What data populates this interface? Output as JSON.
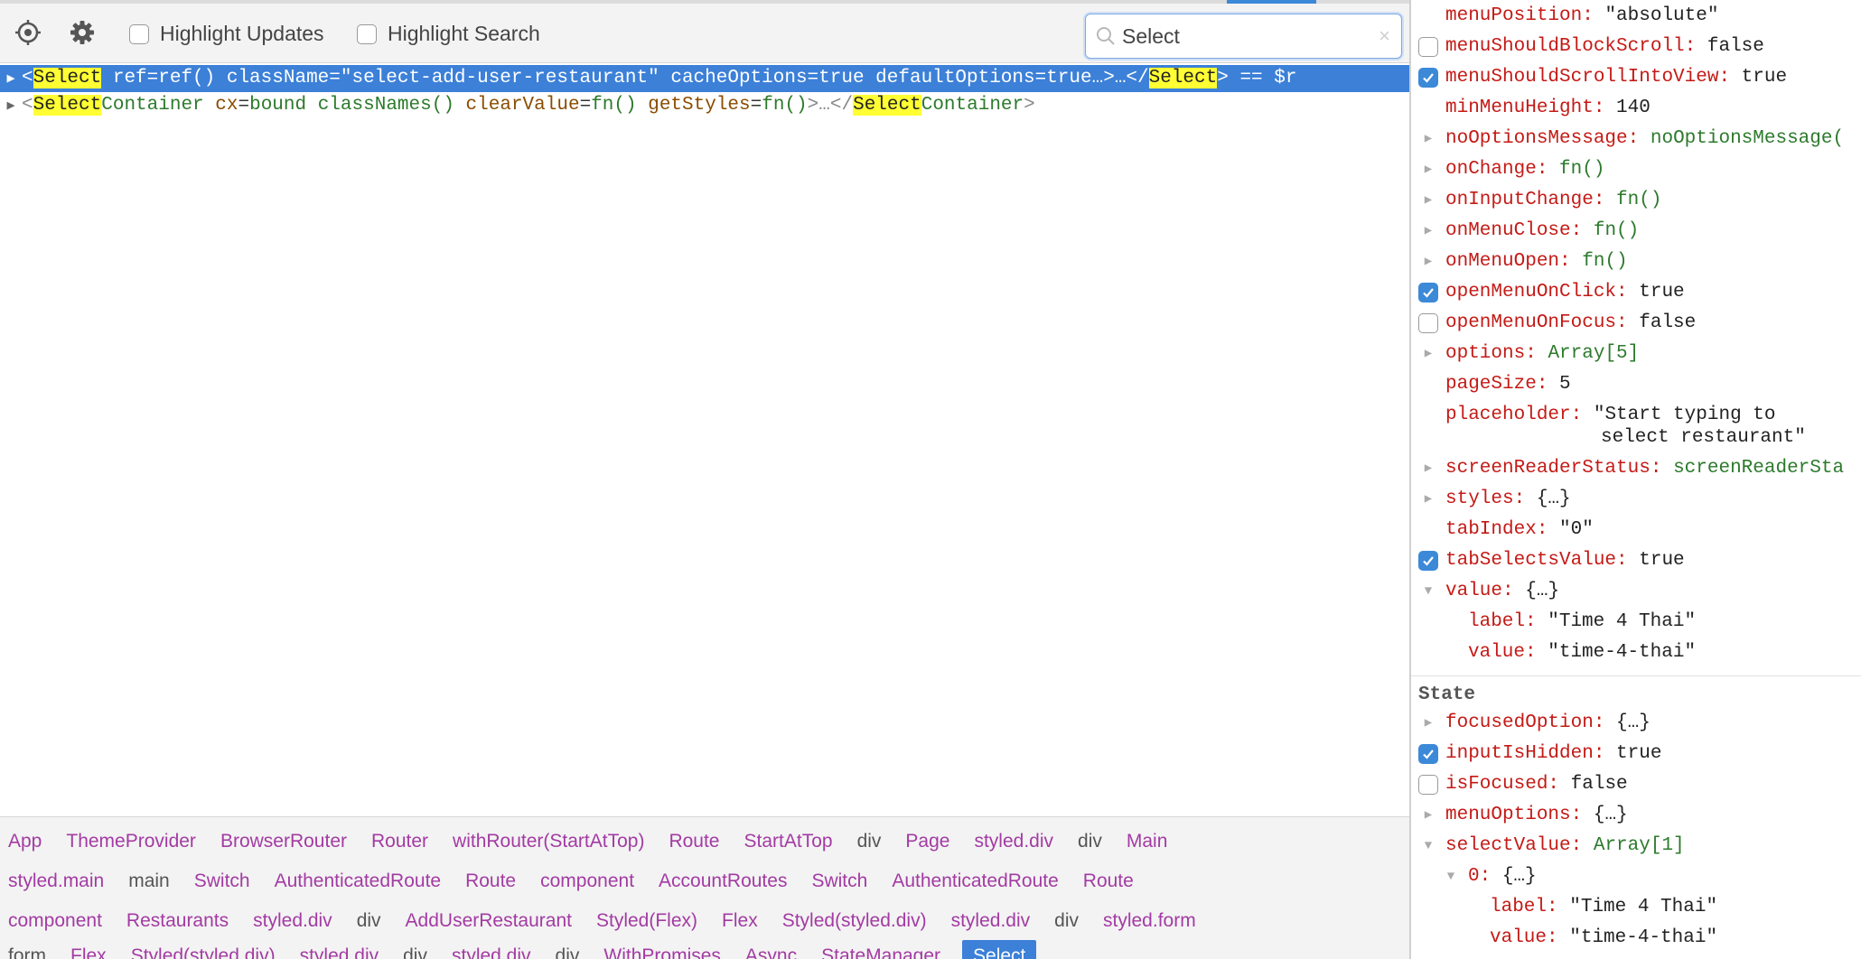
{
  "toolbar": {
    "target_icon": "crosshair-target-icon",
    "settings_icon": "gear-icon",
    "highlight_updates_label": "Highlight Updates",
    "highlight_search_label": "Highlight Search",
    "search_value": "Select",
    "search_icon": "search-icon",
    "clear_icon": "close-icon",
    "clear_glyph": "×"
  },
  "tree": {
    "row1": {
      "open": "<",
      "name": "Select",
      "attrs": " ref=ref() className=\"select-add-user-restaurant\" cacheOptions=true defaultOptions=true…>…</",
      "close_name": "Select",
      "tail": "> == $r"
    },
    "row2": {
      "open": "<",
      "name_hl": "Select",
      "name_rest": "Container",
      "a1n": "cx",
      "a1v": "bound classNames()",
      "a2n": "clearValue",
      "a2v": "fn()",
      "a3n": "getStyles",
      "a3v": "fn()",
      "mid": ">…</",
      "close_hl": "Select",
      "close_rest": "Container",
      "end": ">"
    }
  },
  "breadcrumbs": {
    "row1": [
      "App",
      "ThemeProvider",
      "BrowserRouter",
      "Router",
      "withRouter(StartAtTop)",
      "Route",
      "StartAtTop",
      "div",
      "Page",
      "styled.div",
      "div",
      "Main"
    ],
    "row2": [
      "styled.main",
      "main",
      "Switch",
      "AuthenticatedRoute",
      "Route",
      "component",
      "AccountRoutes",
      "Switch",
      "AuthenticatedRoute",
      "Route"
    ],
    "row3": [
      "component",
      "Restaurants",
      "styled.div",
      "div",
      "AddUserRestaurant",
      "Styled(Flex)",
      "Flex",
      "Styled(styled.div)",
      "styled.div",
      "div",
      "styled.form"
    ],
    "row4": [
      "form",
      "Flex",
      "Styled(styled.div)",
      "styled.div",
      "div",
      "styled.div",
      "div",
      "WithPromises",
      "Async",
      "StateManager",
      "Select"
    ]
  },
  "props": {
    "menuPosition": {
      "key": "menuPosition:",
      "val": "\"absolute\""
    },
    "menuShouldBlockScroll": {
      "key": "menuShouldBlockScroll:",
      "val": "false"
    },
    "menuShouldScrollIntoView": {
      "key": "menuShouldScrollIntoView:",
      "val": "true"
    },
    "minMenuHeight": {
      "key": "minMenuHeight:",
      "val": "140"
    },
    "noOptionsMessage": {
      "key": "noOptionsMessage:",
      "val": "noOptionsMessage("
    },
    "onChange": {
      "key": "onChange:",
      "val": "fn()"
    },
    "onInputChange": {
      "key": "onInputChange:",
      "val": "fn()"
    },
    "onMenuClose": {
      "key": "onMenuClose:",
      "val": "fn()"
    },
    "onMenuOpen": {
      "key": "onMenuOpen:",
      "val": "fn()"
    },
    "openMenuOnClick": {
      "key": "openMenuOnClick:",
      "val": "true"
    },
    "openMenuOnFocus": {
      "key": "openMenuOnFocus:",
      "val": "false"
    },
    "options": {
      "key": "options:",
      "val": "Array[5]"
    },
    "pageSize": {
      "key": "pageSize:",
      "val": "5"
    },
    "placeholder": {
      "key": "placeholder:",
      "val_line1": "\"Start typing to",
      "val_line2": "select restaurant\""
    },
    "screenReaderStatus": {
      "key": "screenReaderStatus:",
      "val": "screenReaderSta"
    },
    "styles": {
      "key": "styles:",
      "val": "{…}"
    },
    "tabIndex": {
      "key": "tabIndex:",
      "val": "\"0\""
    },
    "tabSelectsValue": {
      "key": "tabSelectsValue:",
      "val": "true"
    },
    "value": {
      "key": "value:",
      "val": "{…}"
    },
    "value_label": {
      "key": "label:",
      "val": "\"Time 4 Thai\""
    },
    "value_value": {
      "key": "value:",
      "val": "\"time-4-thai\""
    }
  },
  "state": {
    "heading": "State",
    "focusedOption": {
      "key": "focusedOption:",
      "val": "{…}"
    },
    "inputIsHidden": {
      "key": "inputIsHidden:",
      "val": "true"
    },
    "isFocused": {
      "key": "isFocused:",
      "val": "false"
    },
    "menuOptions": {
      "key": "menuOptions:",
      "val": "{…}"
    },
    "selectValue": {
      "key": "selectValue:",
      "val": "Array[1]"
    },
    "item0": {
      "key": "0:",
      "val": "{…}"
    },
    "item0_label": {
      "key": "label:",
      "val": "\"Time 4 Thai\""
    },
    "item0_value": {
      "key": "value:",
      "val": "\"time-4-thai\""
    }
  },
  "colors": {
    "accent": "#3c80d8",
    "highlight": "#ffff33",
    "prop_key": "#c41a16",
    "component_crumb": "#a33ba3"
  }
}
